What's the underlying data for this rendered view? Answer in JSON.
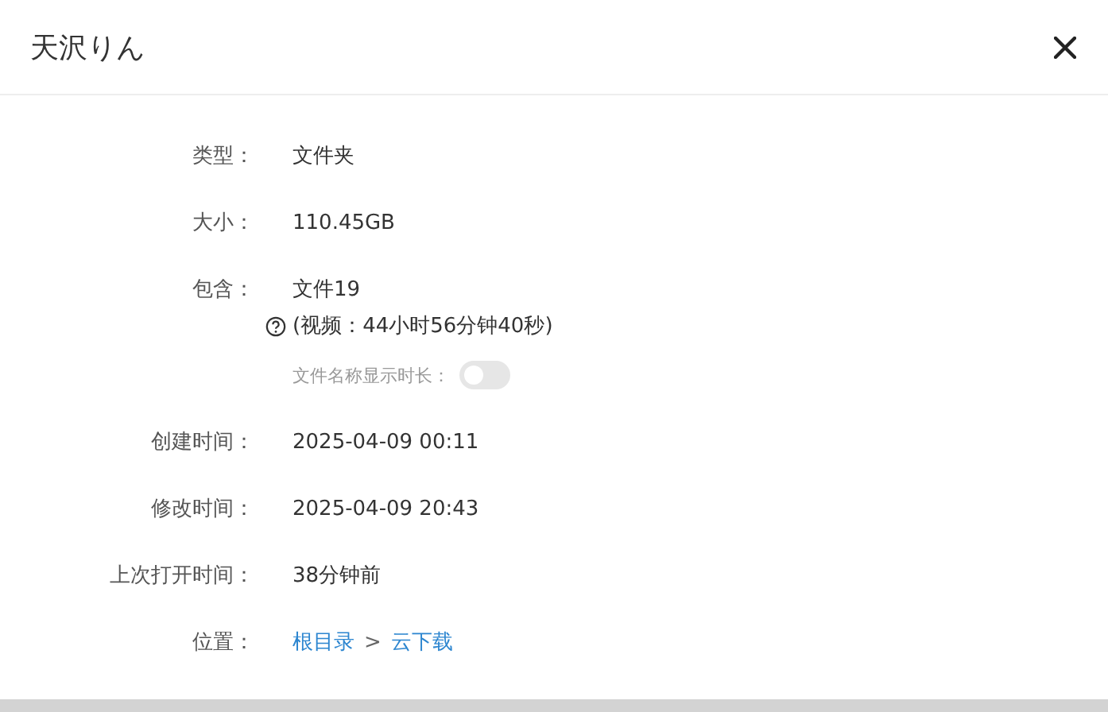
{
  "dialog": {
    "title": "天沢りん"
  },
  "properties": [
    {
      "kind": "text",
      "label": "类型：",
      "value": "文件夹"
    },
    {
      "kind": "text",
      "label": "大小：",
      "value": "110.45GB"
    },
    {
      "kind": "contains",
      "label": "包含：",
      "value": "文件19",
      "note": "(视频：44小时56分钟40秒)",
      "toggle": {
        "label": "文件名称显示时长：",
        "on": false
      }
    },
    {
      "kind": "text",
      "label": "创建时间：",
      "value": "2025-04-09 00:11"
    },
    {
      "kind": "text",
      "label": "修改时间：",
      "value": "2025-04-09 20:43"
    },
    {
      "kind": "text",
      "label": "上次打开时间：",
      "value": "38分钟前"
    },
    {
      "kind": "path",
      "label": "位置：",
      "path": [
        "根目录",
        "云下载"
      ],
      "separator": ">"
    }
  ]
}
